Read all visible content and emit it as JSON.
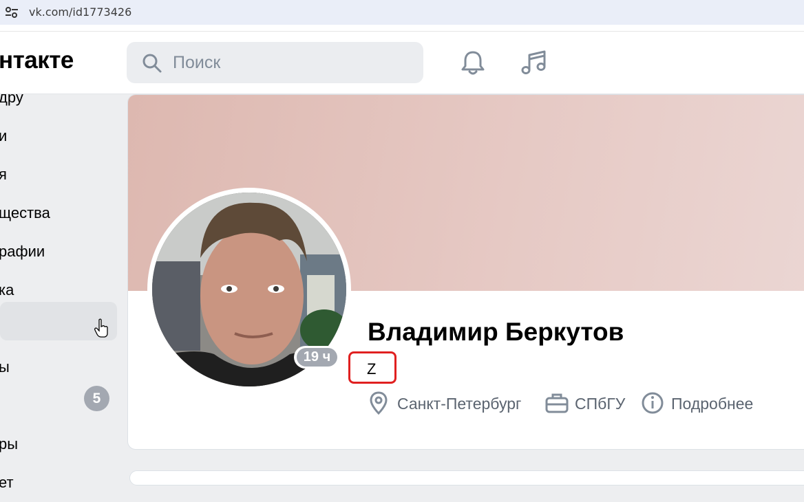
{
  "browser": {
    "url": "vk.com/id1773426"
  },
  "header": {
    "logo": "нтакте",
    "search_placeholder": "Поиск"
  },
  "sidebar": {
    "items": [
      {
        "label": "дру"
      },
      {
        "label": "и"
      },
      {
        "label": "я"
      },
      {
        "label": "щества"
      },
      {
        "label": "рафии"
      },
      {
        "label": "ка"
      },
      {
        "label": ""
      },
      {
        "label": "ы"
      },
      {
        "label": ""
      },
      {
        "label": "ры"
      },
      {
        "label": "ет"
      }
    ],
    "badge": "5"
  },
  "profile": {
    "name": "Владимир Беркутов",
    "status": "Z",
    "story_age": "19 ч",
    "city": "Санкт-Петербург",
    "university": "СПбГУ",
    "more_label": "Подробнее"
  },
  "colors": {
    "accent_badge": "#a3a8b1",
    "status_highlight": "#e02020",
    "muted_text": "#5b6470"
  }
}
